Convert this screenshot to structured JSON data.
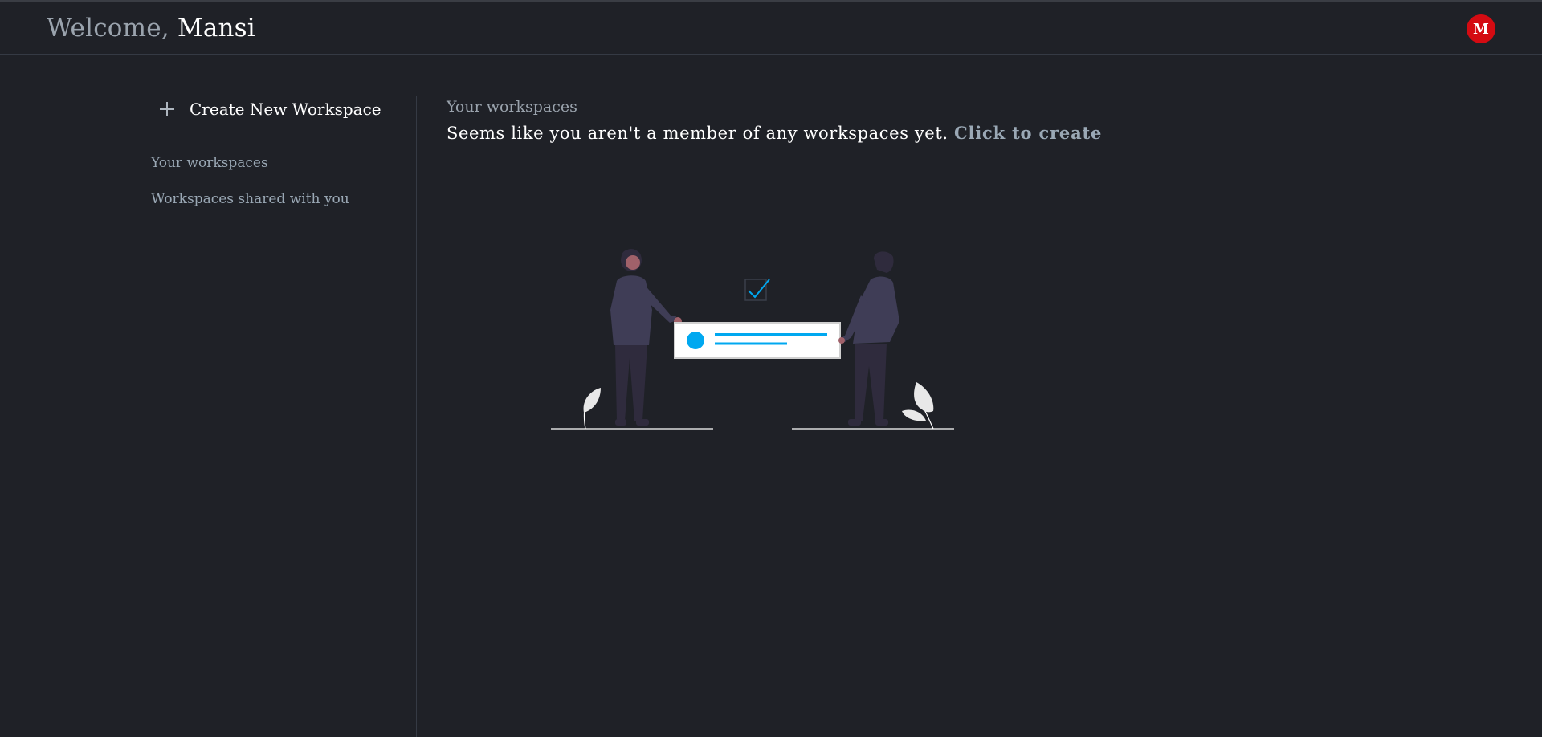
{
  "header": {
    "welcome_prefix": "Welcome,",
    "user_name": "Mansi",
    "avatar_initial": "M",
    "avatar_color": "#d40b12"
  },
  "sidebar": {
    "create_label": "Create New Workspace",
    "items": [
      {
        "label": "Your workspaces"
      },
      {
        "label": "Workspaces shared with you"
      }
    ]
  },
  "main": {
    "section_title": "Your workspaces",
    "empty_message": "Seems like you aren't a member of any workspaces yet.",
    "create_link": "Click to create"
  },
  "colors": {
    "background": "#1f2127",
    "accent": "#00a8f0"
  }
}
